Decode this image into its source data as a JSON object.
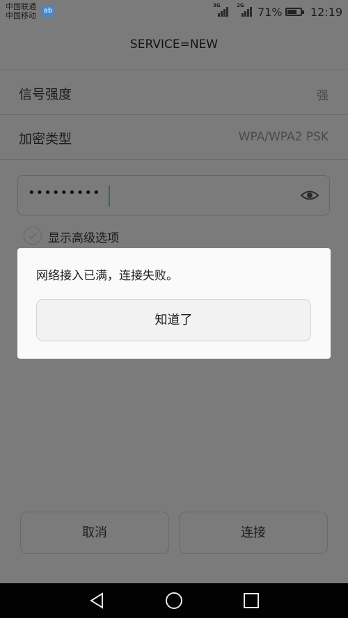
{
  "status_bar": {
    "carriers": [
      "中国联通",
      "中国移动"
    ],
    "app_icon": "ab",
    "signal_1_tag": "3G",
    "signal_2_tag": "2G",
    "battery_percent": "71%",
    "time": "12:19",
    "battery_level": 0.71
  },
  "header": {
    "title": "SERVICE=NEW"
  },
  "rows": [
    {
      "label": "信号强度",
      "value": "强"
    },
    {
      "label": "加密类型",
      "value": "WPA/WPA2 PSK"
    }
  ],
  "password": {
    "masked_value": "•••••••••",
    "icon": "eye-icon"
  },
  "advanced": {
    "label": "显示高级选项"
  },
  "dialog": {
    "message": "网络接入已满，连接失败。",
    "ok_label": "知道了"
  },
  "actions": {
    "cancel_label": "取消",
    "connect_label": "连接"
  },
  "nav": {
    "back_icon": "back-triangle-icon",
    "home_icon": "home-circle-icon",
    "recents_icon": "recents-square-icon"
  }
}
